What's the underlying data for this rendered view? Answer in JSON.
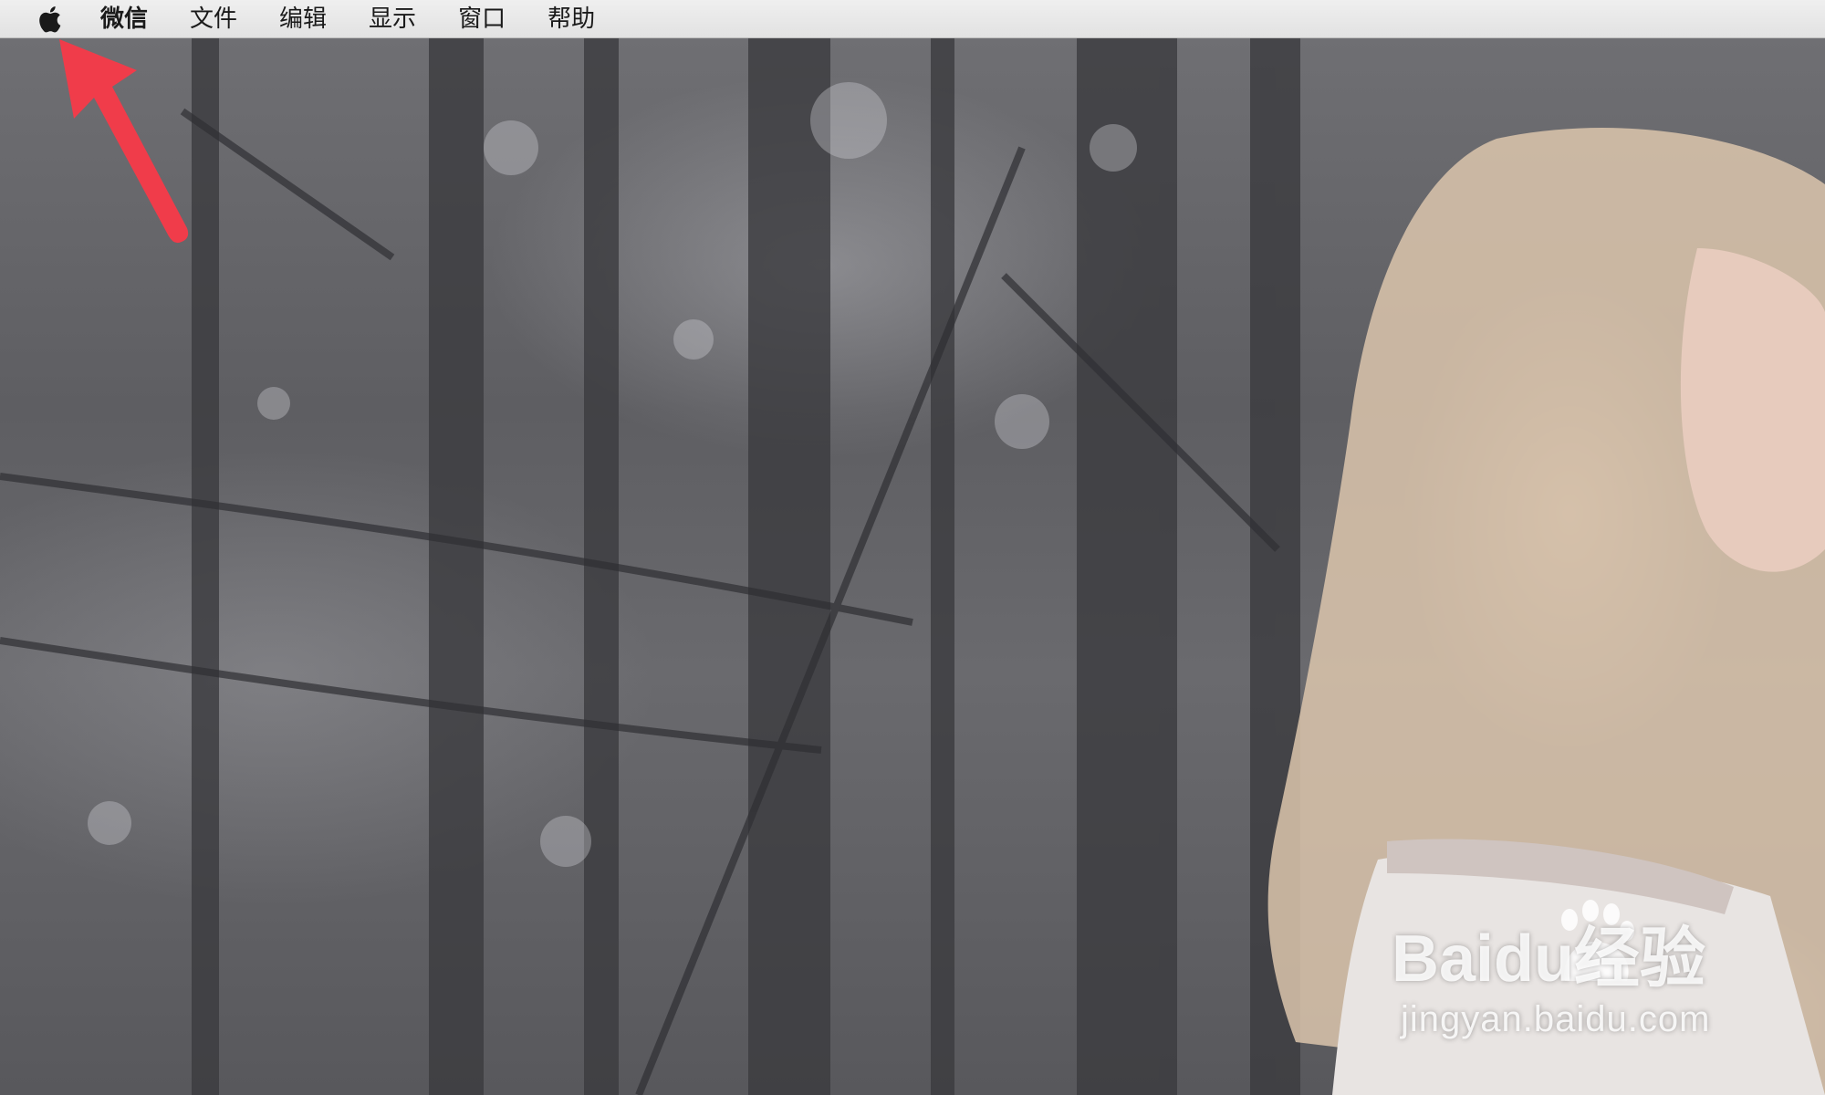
{
  "menubar": {
    "apple_icon": "apple-logo-icon",
    "app_name": "微信",
    "items": [
      {
        "label": "文件"
      },
      {
        "label": "编辑"
      },
      {
        "label": "显示"
      },
      {
        "label": "窗口"
      },
      {
        "label": "帮助"
      }
    ]
  },
  "annotation": {
    "arrow_color": "#f03c4a",
    "icon": "red-arrow-icon"
  },
  "watermark": {
    "logo_text": "Baidu经验",
    "url": "jingyan.baidu.com"
  },
  "colors": {
    "menubar_bg": "#e8e8e8",
    "menu_text": "#1a1a1a",
    "accent": "#f03c4a"
  }
}
